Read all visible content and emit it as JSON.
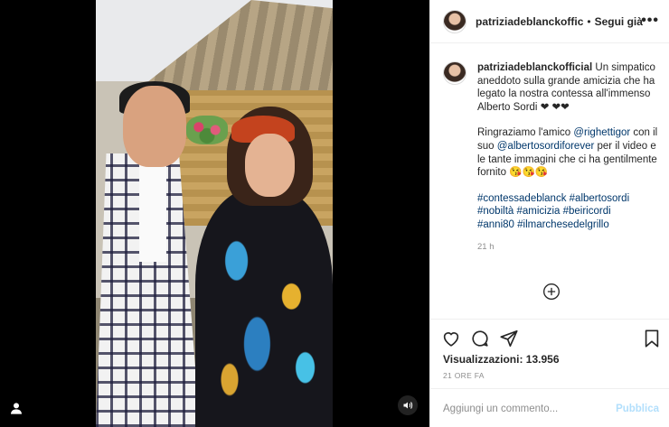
{
  "header": {
    "username": "patriziadeblanckoffic",
    "separator": "•",
    "follow_label": "Segui già",
    "more_icon": "more-horizontal-icon"
  },
  "caption": {
    "username": "patriziadeblanckofficial",
    "text_1": "Un simpatico aneddoto sulla grande amicizia che ha legato la nostra contessa all'immenso Alberto Sordi",
    "emoji_hearts_1": "❤",
    "emoji_hearts_2": "❤❤",
    "thanks_prefix": "Ringraziamo l'amico ",
    "mention_1": "@righettigor",
    "thanks_mid": " con il suo ",
    "mention_2": "@albertosordiforever",
    "thanks_suffix": " per il video e le tante immagini che ci ha gentilmente fornito ",
    "emoji_kisses": "😘😘😘",
    "hashtags_line_1": "#contessadeblanck #albertosordi",
    "hashtags_line_2": "#nobiltà #amicizia #beiricordi",
    "hashtags_line_3": "#anni80 #ilmarchesedelgrillo",
    "time": "21 h"
  },
  "stats": {
    "views_label": "Visualizzazioni: 13.956",
    "ago": "21 ORE FA"
  },
  "comment": {
    "placeholder": "Aggiungi un commento...",
    "publish_label": "Pubblica"
  },
  "colors": {
    "link": "#00376b",
    "publish_disabled": "#b2dffc",
    "muted": "#8e8e8e"
  }
}
